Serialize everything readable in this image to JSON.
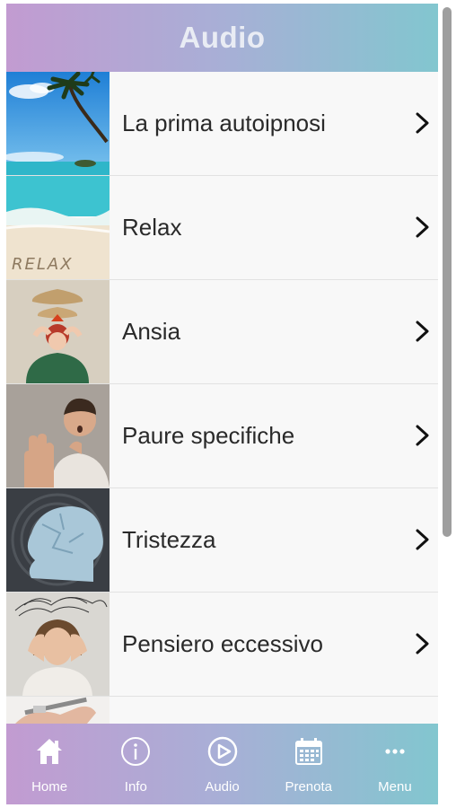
{
  "header": {
    "title": "Audio"
  },
  "list": {
    "items": [
      {
        "label": "La prima autoipnosi",
        "thumb": "palm-beach-image"
      },
      {
        "label": "Relax",
        "thumb": "relax-sand-image"
      },
      {
        "label": "Ansia",
        "thumb": "anxious-woman-image"
      },
      {
        "label": "Paure specifiche",
        "thumb": "scared-man-image"
      },
      {
        "label": "Tristezza",
        "thumb": "paper-head-image"
      },
      {
        "label": "Pensiero eccessivo",
        "thumb": "overthinking-woman-image"
      },
      {
        "label": "",
        "thumb": "hand-pen-image"
      }
    ]
  },
  "tabbar": {
    "tabs": [
      {
        "label": "Home",
        "icon": "home-icon"
      },
      {
        "label": "Info",
        "icon": "info-icon"
      },
      {
        "label": "Audio",
        "icon": "play-icon"
      },
      {
        "label": "Prenota",
        "icon": "calendar-icon"
      },
      {
        "label": "Menu",
        "icon": "more-icon"
      }
    ]
  },
  "colors": {
    "gradient_start": "#c29bd1",
    "gradient_end": "#82c6cf",
    "title_text": "#e9ecf4",
    "list_background": "#f8f8f8"
  }
}
